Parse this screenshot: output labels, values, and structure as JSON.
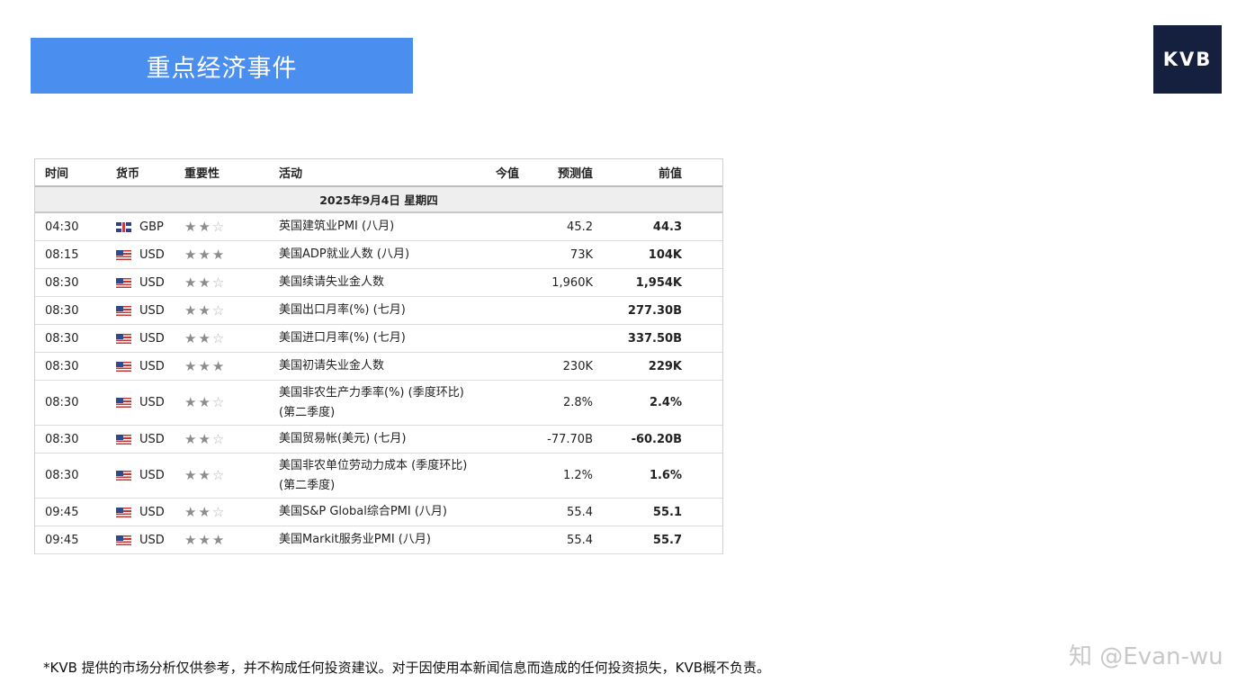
{
  "banner": {
    "title": "重点经济事件"
  },
  "logo": {
    "text": "KVB"
  },
  "calendar": {
    "columns": {
      "time": "时间",
      "currency": "货币",
      "importance": "重要性",
      "event": "活动",
      "actual": "今值",
      "forecast": "预测值",
      "previous": "前值"
    },
    "date": "2025年9月4日  星期四",
    "rows": [
      {
        "time": "04:30",
        "flag": "gb",
        "currency": "GBP",
        "stars": 2,
        "event": "英国建筑业PMI (八月)",
        "actual": "",
        "forecast": "45.2",
        "previous": "44.3"
      },
      {
        "time": "08:15",
        "flag": "us",
        "currency": "USD",
        "stars": 3,
        "event": "美国ADP就业人数 (八月)",
        "actual": "",
        "forecast": "73K",
        "previous": "104K"
      },
      {
        "time": "08:30",
        "flag": "us",
        "currency": "USD",
        "stars": 2,
        "event": "美国续请失业金人数",
        "actual": "",
        "forecast": "1,960K",
        "previous": "1,954K"
      },
      {
        "time": "08:30",
        "flag": "us",
        "currency": "USD",
        "stars": 2,
        "event": "美国出口月率(%) (七月)",
        "actual": "",
        "forecast": "",
        "previous": "277.30B"
      },
      {
        "time": "08:30",
        "flag": "us",
        "currency": "USD",
        "stars": 2,
        "event": "美国进口月率(%) (七月)",
        "actual": "",
        "forecast": "",
        "previous": "337.50B"
      },
      {
        "time": "08:30",
        "flag": "us",
        "currency": "USD",
        "stars": 3,
        "event": "美国初请失业金人数",
        "actual": "",
        "forecast": "230K",
        "previous": "229K"
      },
      {
        "time": "08:30",
        "flag": "us",
        "currency": "USD",
        "stars": 2,
        "event": "美国非农生产力季率(%) (季度环比) (第二季度)",
        "actual": "",
        "forecast": "2.8%",
        "previous": "2.4%",
        "tall": true
      },
      {
        "time": "08:30",
        "flag": "us",
        "currency": "USD",
        "stars": 2,
        "event": "美国贸易帐(美元) (七月)",
        "actual": "",
        "forecast": "-77.70B",
        "previous": "-60.20B"
      },
      {
        "time": "08:30",
        "flag": "us",
        "currency": "USD",
        "stars": 2,
        "event": "美国非农单位劳动力成本 (季度环比) (第二季度)",
        "actual": "",
        "forecast": "1.2%",
        "previous": "1.6%",
        "tall": true
      },
      {
        "time": "09:45",
        "flag": "us",
        "currency": "USD",
        "stars": 2,
        "event": "美国S&P Global综合PMI (八月)",
        "actual": "",
        "forecast": "55.4",
        "previous": "55.1"
      },
      {
        "time": "09:45",
        "flag": "us",
        "currency": "USD",
        "stars": 3,
        "event": "美国Markit服务业PMI (八月)",
        "actual": "",
        "forecast": "55.4",
        "previous": "55.7"
      }
    ]
  },
  "disclaimer": "*KVB 提供的市场分析仅供参考，并不构成任何投资建议。对于因使用本新闻信息而造成的任何投资损失，KVB概不负责。",
  "watermark": "知 @Evan-wu",
  "icons": {
    "star": "star-icon",
    "flag_us": "us-flag-icon",
    "flag_gb": "gb-flag-icon"
  },
  "colors": {
    "banner": "#4a8ef0",
    "logo_bg": "#14203d"
  }
}
